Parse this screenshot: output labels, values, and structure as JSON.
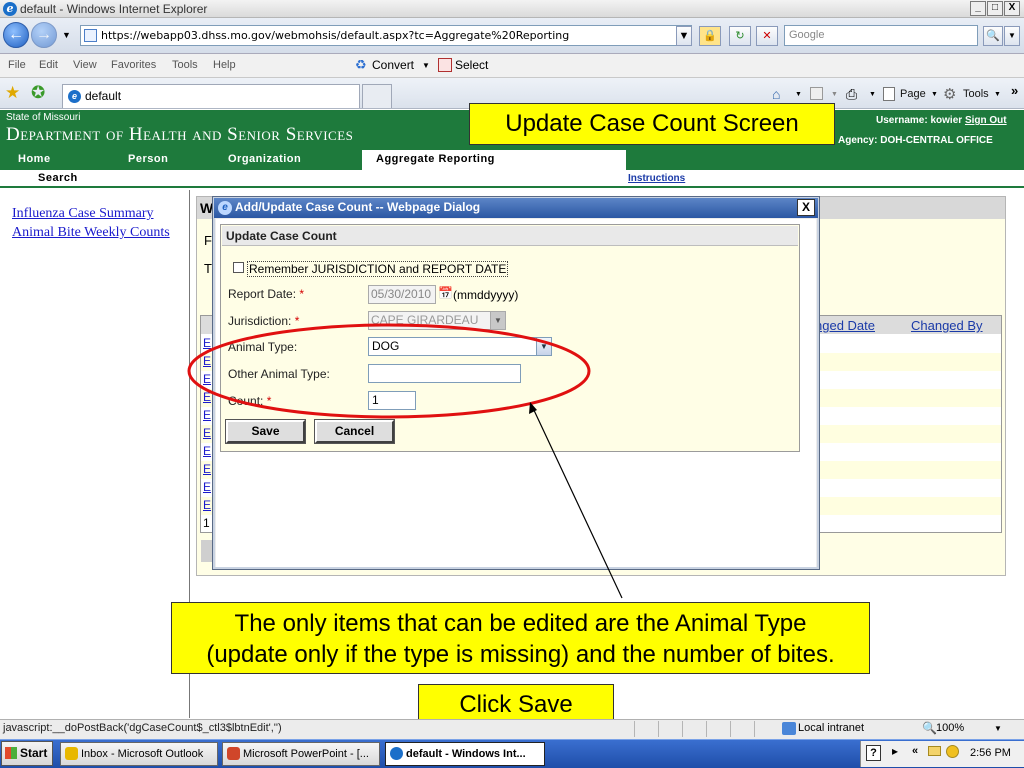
{
  "window": {
    "title": "default - Windows Internet Explorer",
    "minimize": "_",
    "maximize": "□",
    "close": "X"
  },
  "address_bar": {
    "url": "https://webapp03.dhss.mo.gov/webmohsis/default.aspx?tc=Aggregate%20Reporting",
    "search_placeholder": "Google"
  },
  "menu": {
    "items": [
      "File",
      "Edit",
      "View",
      "Favorites",
      "Tools",
      "Help"
    ],
    "convert_label": "Convert",
    "select_label": "Select"
  },
  "tabs": {
    "current_tab": "default"
  },
  "commandbar": {
    "page_label": "Page",
    "tools_label": "Tools",
    "more": "»"
  },
  "site": {
    "state_label": "State of Missouri",
    "department": "Department of Health and Senior Services",
    "username_label": "Username:",
    "username": "kowier",
    "sign_out": "Sign Out",
    "agency_label": "Agency:",
    "agency": "DOH-CENTRAL OFFICE",
    "nav": [
      "Home",
      "Person",
      "Organization",
      "Aggregate Reporting"
    ],
    "subnav_search": "Search",
    "instructions": "Instructions"
  },
  "left_nav": {
    "links": [
      "Influenza Case Summary",
      "Animal Bite Weekly Counts"
    ]
  },
  "background_grid": {
    "head_letter": "W",
    "letters": [
      "F",
      "T"
    ],
    "row_link": "E",
    "footer_number": "1",
    "columns": [
      "nged Date",
      "Changed By"
    ]
  },
  "dialog": {
    "title": "Add/Update Case Count -- Webpage Dialog",
    "close": "X",
    "form_title": "Update Case Count",
    "remember_label": "Remember JURISDICTION and REPORT DATE",
    "report_date_label": "Report Date:",
    "report_date_value": "05/30/2010",
    "date_format": "(mmddyyyy)",
    "jurisdiction_label": "Jurisdiction:",
    "jurisdiction_value": "CAPE GIRARDEAU",
    "animal_type_label": "Animal Type:",
    "animal_type_value": "DOG",
    "other_animal_label": "Other Animal Type:",
    "other_animal_value": "",
    "count_label": "Count:",
    "count_value": "1",
    "required_mark": "*",
    "save": "Save",
    "cancel": "Cancel"
  },
  "callouts": {
    "title": "Update Case Count Screen",
    "note_line1": "The only items that can be edited are the Animal Type",
    "note_line2": "(update only if the type is missing) and the number of bites.",
    "save": "Click Save"
  },
  "statusbar": {
    "text": "javascript:__doPostBack('dgCaseCount$_ctl3$lbtnEdit','')",
    "zone": "Local intranet",
    "zoom": "100%"
  },
  "taskbar": {
    "start": "Start",
    "tasks": [
      "Inbox - Microsoft Outlook",
      "Microsoft PowerPoint - [...",
      "default - Windows Int..."
    ],
    "clock": "2:56 PM"
  },
  "colors": {
    "site_green": "#1e7a3c",
    "callout_yellow": "#ffff00",
    "annotation_red": "#e01010"
  }
}
